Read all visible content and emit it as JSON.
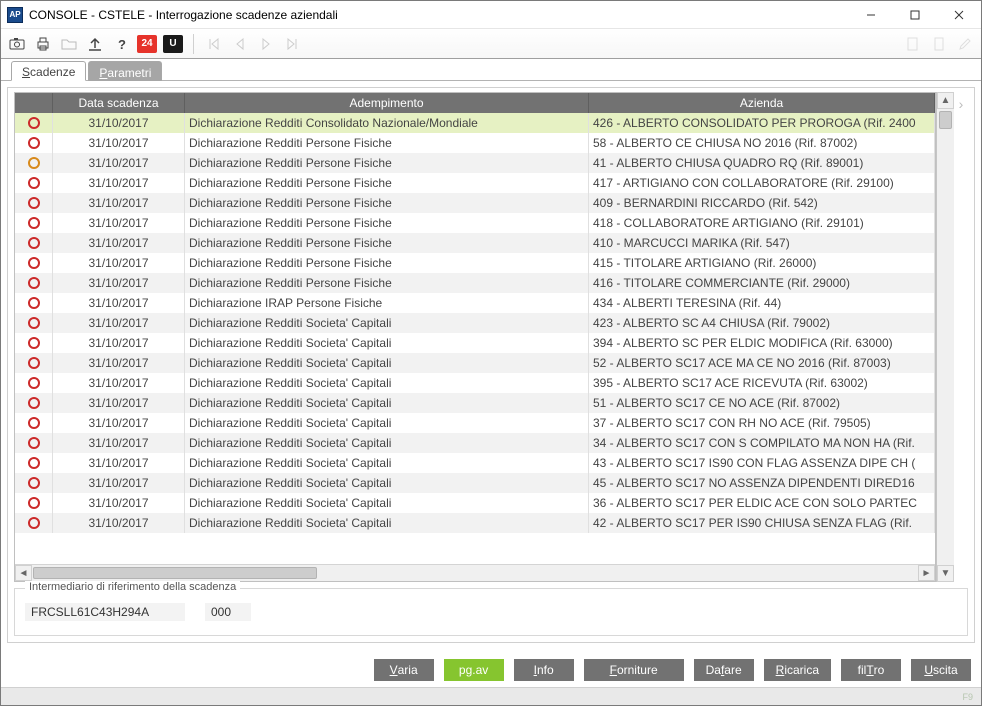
{
  "window": {
    "title": "CONSOLE  - CSTELE -   Interrogazione scadenze aziendali"
  },
  "toolbar": {
    "red_badge": "24",
    "black_badge": "U"
  },
  "tabs": {
    "active": "Scadenze",
    "inactive": "Parametri"
  },
  "grid": {
    "headers": {
      "date": "Data scadenza",
      "adem": "Adempimento",
      "azienda": "Azienda"
    },
    "rows": [
      {
        "status": "red",
        "date": "31/10/2017",
        "adem": "Dichiarazione Redditi Consolidato Nazionale/Mondiale",
        "az": "426 - ALBERTO CONSOLIDATO PER PROROGA (Rif. 2400",
        "selected": true
      },
      {
        "status": "red",
        "date": "31/10/2017",
        "adem": "Dichiarazione Redditi Persone Fisiche",
        "az": "58 - ALBERTO CE CHIUSA NO 2016 (Rif. 87002)"
      },
      {
        "status": "orange",
        "date": "31/10/2017",
        "adem": "Dichiarazione Redditi Persone Fisiche",
        "az": "41 - ALBERTO CHIUSA QUADRO RQ (Rif. 89001)"
      },
      {
        "status": "red",
        "date": "31/10/2017",
        "adem": "Dichiarazione Redditi Persone Fisiche",
        "az": "417 - ARTIGIANO CON COLLABORATORE (Rif. 29100)"
      },
      {
        "status": "red",
        "date": "31/10/2017",
        "adem": "Dichiarazione Redditi Persone Fisiche",
        "az": "409 - BERNARDINI RICCARDO (Rif. 542)"
      },
      {
        "status": "red",
        "date": "31/10/2017",
        "adem": "Dichiarazione Redditi Persone Fisiche",
        "az": "418 - COLLABORATORE ARTIGIANO (Rif. 29101)"
      },
      {
        "status": "red",
        "date": "31/10/2017",
        "adem": "Dichiarazione Redditi Persone Fisiche",
        "az": "410 - MARCUCCI MARIKA (Rif. 547)"
      },
      {
        "status": "red",
        "date": "31/10/2017",
        "adem": "Dichiarazione Redditi Persone Fisiche",
        "az": "415 - TITOLARE ARTIGIANO (Rif. 26000)"
      },
      {
        "status": "red",
        "date": "31/10/2017",
        "adem": "Dichiarazione Redditi Persone Fisiche",
        "az": "416 - TITOLARE COMMERCIANTE (Rif. 29000)"
      },
      {
        "status": "red",
        "date": "31/10/2017",
        "adem": "Dichiarazione IRAP Persone Fisiche",
        "az": "434 - ALBERTI TERESINA (Rif. 44)"
      },
      {
        "status": "red",
        "date": "31/10/2017",
        "adem": "Dichiarazione Redditi Societa' Capitali",
        "az": "423 - ALBERTO SC A4 CHIUSA (Rif. 79002)"
      },
      {
        "status": "red",
        "date": "31/10/2017",
        "adem": "Dichiarazione Redditi Societa' Capitali",
        "az": "394 - ALBERTO SC PER ELDIC MODIFICA (Rif. 63000)"
      },
      {
        "status": "red",
        "date": "31/10/2017",
        "adem": "Dichiarazione Redditi Societa' Capitali",
        "az": "52 - ALBERTO SC17 ACE MA CE NO 2016 (Rif. 87003)"
      },
      {
        "status": "red",
        "date": "31/10/2017",
        "adem": "Dichiarazione Redditi Societa' Capitali",
        "az": "395 - ALBERTO SC17 ACE RICEVUTA (Rif. 63002)"
      },
      {
        "status": "red",
        "date": "31/10/2017",
        "adem": "Dichiarazione Redditi Societa' Capitali",
        "az": "51 - ALBERTO SC17 CE NO ACE (Rif. 87002)"
      },
      {
        "status": "red",
        "date": "31/10/2017",
        "adem": "Dichiarazione Redditi Societa' Capitali",
        "az": "37 - ALBERTO SC17 CON RH NO ACE (Rif. 79505)"
      },
      {
        "status": "red",
        "date": "31/10/2017",
        "adem": "Dichiarazione Redditi Societa' Capitali",
        "az": "34 - ALBERTO SC17 CON S COMPILATO MA NON HA (Rif."
      },
      {
        "status": "red",
        "date": "31/10/2017",
        "adem": "Dichiarazione Redditi Societa' Capitali",
        "az": "43 - ALBERTO SC17 IS90 CON FLAG ASSENZA DIPE CH ("
      },
      {
        "status": "red",
        "date": "31/10/2017",
        "adem": "Dichiarazione Redditi Societa' Capitali",
        "az": "45 - ALBERTO SC17 NO ASSENZA DIPENDENTI DIRED16"
      },
      {
        "status": "red",
        "date": "31/10/2017",
        "adem": "Dichiarazione Redditi Societa' Capitali",
        "az": "36 - ALBERTO SC17 PER ELDIC ACE CON SOLO PARTEC"
      },
      {
        "status": "red",
        "date": "31/10/2017",
        "adem": "Dichiarazione Redditi Societa' Capitali",
        "az": "42 - ALBERTO SC17 PER IS90 CHIUSA SENZA FLAG (Rif."
      }
    ]
  },
  "intermediario": {
    "legend": "Intermediario di riferimento della scadenza",
    "codice_fiscale": "FRCSLL61C43H294A",
    "codice": "000"
  },
  "buttons": {
    "varia": {
      "full": "Varia",
      "ul": "V",
      "rest": "aria"
    },
    "pgav": {
      "full": "pg.av"
    },
    "info": {
      "full": "Info",
      "ul": "I",
      "rest": "nfo"
    },
    "forniture": {
      "full": "Forniture",
      "ul": "F",
      "rest": "orniture"
    },
    "dafare": {
      "pre": "Da",
      "ul": "f",
      "rest": "are"
    },
    "ricarica": {
      "full": "Ricarica",
      "ul": "R",
      "rest": "icarica"
    },
    "filtro": {
      "pre": "fil",
      "ul": "T",
      "rest": "ro"
    },
    "uscita": {
      "full": "Uscita",
      "ul": "U",
      "rest": "scita"
    }
  },
  "statusbar": {
    "hint": "F9"
  }
}
